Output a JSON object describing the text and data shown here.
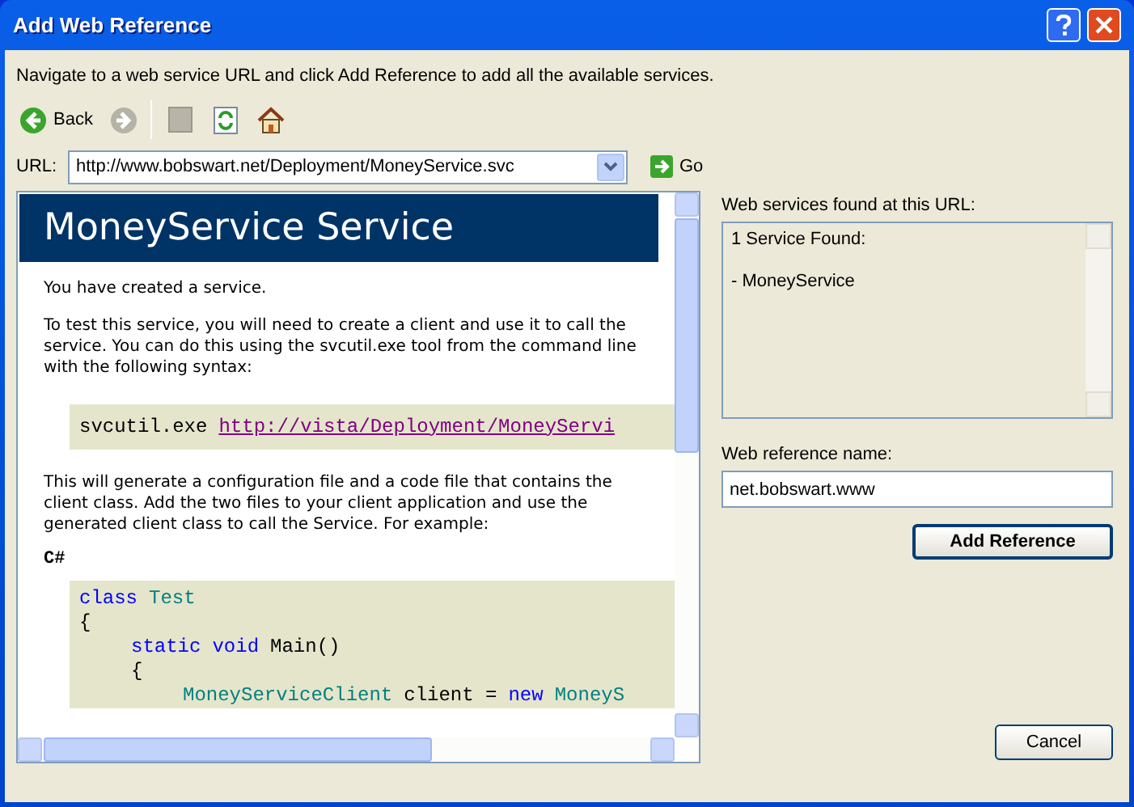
{
  "window": {
    "title": "Add Web Reference"
  },
  "instruction": "Navigate to a web service URL and click Add Reference to add all the available services.",
  "toolbar": {
    "back_label": "Back",
    "forward_disabled": true
  },
  "url": {
    "label": "URL:",
    "value": "http://www.bobswart.net/Deployment/MoneyService.svc",
    "go_label": "Go"
  },
  "browser": {
    "heading": "MoneyService Service",
    "paragraphs": [
      "You have created a service.",
      "To test this service, you will need to create a client and use it to call the service. You can do this using the svcutil.exe tool from the command line with the following syntax:"
    ],
    "command": {
      "tool": "svcutil.exe",
      "link": "http://vista/Deployment/MoneyServi"
    },
    "paragraph_after": "This will generate a configuration file and a code file that contains the client class. Add the two files to your client application and use the generated client class to call the Service. For example:",
    "language": "C#",
    "code_lines": [
      [
        {
          "kind": "keyword",
          "text": "class"
        },
        {
          "kind": "type",
          "text": "Test"
        }
      ],
      [
        {
          "kind": "plain",
          "text": "{"
        }
      ],
      [
        {
          "kind": "indent"
        },
        {
          "kind": "keyword",
          "text": "static"
        },
        {
          "kind": "keyword",
          "text": "void"
        },
        {
          "kind": "plain",
          "text": "Main()"
        }
      ],
      [
        {
          "kind": "indent"
        },
        {
          "kind": "plain",
          "text": "{"
        }
      ],
      [
        {
          "kind": "indent"
        },
        {
          "kind": "indent"
        },
        {
          "kind": "type",
          "text": "MoneyServiceClient"
        },
        {
          "kind": "plain",
          "text": "client ="
        },
        {
          "kind": "keyword",
          "text": "new"
        },
        {
          "kind": "type",
          "text": "MoneyS"
        }
      ]
    ]
  },
  "services": {
    "label": "Web services found at this URL:",
    "lines": [
      "1 Service Found:",
      "- MoneyService"
    ]
  },
  "reference_name": {
    "label": "Web reference name:",
    "value": "net.bobswart.www"
  },
  "buttons": {
    "add": "Add Reference",
    "cancel": "Cancel"
  }
}
